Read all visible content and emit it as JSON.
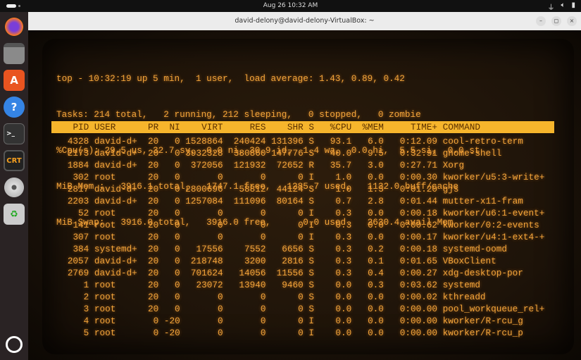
{
  "topbar": {
    "clock": "Aug 26  10:32 AM",
    "tray": [
      "network-icon",
      "volume-icon",
      "battery-icon"
    ]
  },
  "dock": [
    {
      "name": "firefox"
    },
    {
      "name": "files"
    },
    {
      "name": "app-center"
    },
    {
      "name": "help"
    },
    {
      "name": "terminal"
    },
    {
      "name": "cool-retro-term",
      "label": "CRT"
    },
    {
      "name": "disc"
    },
    {
      "name": "trash"
    }
  ],
  "window": {
    "title": "david-delony@david-delony-VirtualBox: ~",
    "minimize": "–",
    "maximize": "◻",
    "close": "×"
  },
  "summary": [
    "top - 10:32:19 up 5 min,  1 user,  load average: 1.43, 0.89, 0.42",
    "Tasks: 214 total,   2 running, 212 sleeping,   0 stopped,   0 zombie",
    "%Cpu(s): 29.5 us, 32.7 sy,  0.0 ni, 30.9 id,  1.4 wa,  0.0 hi,  5.5 si,  0.0 st",
    "MiB Mem :   3916.1 total,   1747.1 free,   1285.7 used,   1132.0 buff/cache",
    "MiB Swap:   3916.0 total,   3916.0 free,      0.0 used.   2630.4 avail Mem"
  ],
  "columns": [
    "PID",
    "USER",
    "PR",
    "NI",
    "VIRT",
    "RES",
    "SHR",
    "S",
    "%CPU",
    "%MEM",
    "TIME+",
    "COMMAND"
  ],
  "processes": [
    [
      "4328",
      "david-d+",
      "20",
      "0",
      "1528864",
      "240424",
      "131396",
      "S",
      "93.1",
      "6.0",
      "0:12.09",
      "cool-retro-term"
    ],
    [
      "2173",
      "david-d+",
      "20",
      "0",
      "3932328",
      "380860",
      "147776",
      "S",
      "40.0",
      "9.5",
      "0:32.91",
      "gnome-shell"
    ],
    [
      "1884",
      "david-d+",
      "20",
      "0",
      "372056",
      "121932",
      "72652",
      "R",
      "35.7",
      "3.0",
      "0:27.71",
      "Xorg"
    ],
    [
      "302",
      "root",
      "20",
      "0",
      "0",
      "0",
      "0",
      "I",
      "1.0",
      "0.0",
      "0:00.30",
      "kworker/u5:3-write+"
    ],
    [
      "2817",
      "david-d+",
      "20",
      "0",
      "2800696",
      "58812",
      "44124",
      "S",
      "1.0",
      "1.5",
      "0:01.20",
      "gjs"
    ],
    [
      "2203",
      "david-d+",
      "20",
      "0",
      "1257084",
      "111096",
      "80164",
      "S",
      "0.7",
      "2.8",
      "0:01.44",
      "mutter-x11-fram"
    ],
    [
      "52",
      "root",
      "20",
      "0",
      "0",
      "0",
      "0",
      "I",
      "0.3",
      "0.0",
      "0:00.18",
      "kworker/u6:1-event+"
    ],
    [
      "141",
      "root",
      "20",
      "0",
      "0",
      "0",
      "0",
      "I",
      "0.3",
      "0.0",
      "0:00.62",
      "kworker/0:2-events"
    ],
    [
      "307",
      "root",
      "20",
      "0",
      "0",
      "0",
      "0",
      "I",
      "0.3",
      "0.0",
      "0:00.17",
      "kworker/u4:1-ext4-+"
    ],
    [
      "384",
      "systemd+",
      "20",
      "0",
      "17556",
      "7552",
      "6656",
      "S",
      "0.3",
      "0.2",
      "0:00.18",
      "systemd-oomd"
    ],
    [
      "2057",
      "david-d+",
      "20",
      "0",
      "218748",
      "3200",
      "2816",
      "S",
      "0.3",
      "0.1",
      "0:01.65",
      "VBoxClient"
    ],
    [
      "2769",
      "david-d+",
      "20",
      "0",
      "701624",
      "14056",
      "11556",
      "S",
      "0.3",
      "0.4",
      "0:00.27",
      "xdg-desktop-por"
    ],
    [
      "1",
      "root",
      "20",
      "0",
      "23072",
      "13940",
      "9460",
      "S",
      "0.0",
      "0.3",
      "0:03.62",
      "systemd"
    ],
    [
      "2",
      "root",
      "20",
      "0",
      "0",
      "0",
      "0",
      "S",
      "0.0",
      "0.0",
      "0:00.02",
      "kthreadd"
    ],
    [
      "3",
      "root",
      "20",
      "0",
      "0",
      "0",
      "0",
      "S",
      "0.0",
      "0.0",
      "0:00.00",
      "pool_workqueue_rel+"
    ],
    [
      "4",
      "root",
      "0",
      "-20",
      "0",
      "0",
      "0",
      "I",
      "0.0",
      "0.0",
      "0:00.00",
      "kworker/R-rcu_g"
    ],
    [
      "5",
      "root",
      "0",
      "-20",
      "0",
      "0",
      "0",
      "I",
      "0.0",
      "0.0",
      "0:00.00",
      "kworker/R-rcu_p"
    ]
  ]
}
